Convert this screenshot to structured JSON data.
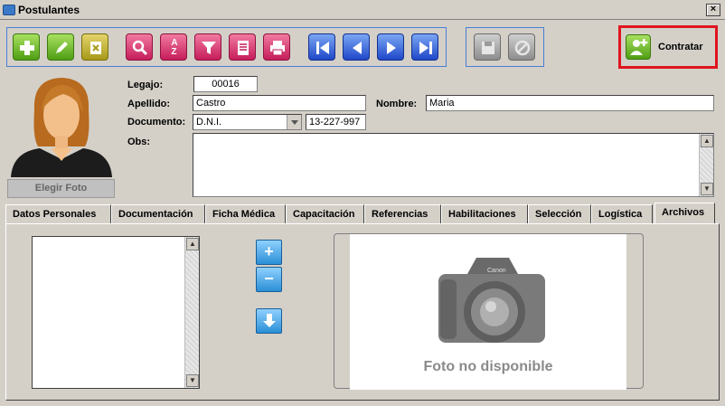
{
  "window": {
    "title": "Postulantes",
    "close": "×"
  },
  "toolbar": {
    "edit_group": [
      "add-icon",
      "edit-icon",
      "delete-icon"
    ],
    "action_group": [
      "search-icon",
      "sort-icon",
      "filter-icon",
      "list-icon",
      "print-icon"
    ],
    "nav_group": [
      "first-icon",
      "prev-icon",
      "next-icon",
      "last-icon"
    ],
    "save_group": [
      "save-icon",
      "cancel-icon"
    ],
    "contratar_label": "Contratar"
  },
  "form": {
    "legajo_label": "Legajo:",
    "legajo_value": "00016",
    "apellido_label": "Apellido:",
    "apellido_value": "Castro",
    "nombre_label": "Nombre:",
    "nombre_value": "Maria",
    "documento_label": "Documento:",
    "documento_type": "D.N.I.",
    "documento_value": "13-227-997",
    "obs_label": "Obs:",
    "obs_value": ""
  },
  "photo": {
    "button_label": "Elegir Foto"
  },
  "tabs": [
    {
      "label": "Datos Personales"
    },
    {
      "label": "Documentación"
    },
    {
      "label": "Ficha Médica"
    },
    {
      "label": "Capacitación"
    },
    {
      "label": "Referencias"
    },
    {
      "label": "Habilitaciones"
    },
    {
      "label": "Selección"
    },
    {
      "label": "Logística"
    },
    {
      "label": "Archivos"
    }
  ],
  "active_tab": "Archivos",
  "archivos": {
    "camera_brand": "Canon",
    "no_photo_text": "Foto no disponible"
  },
  "colors": {
    "highlight_border": "#e0141e",
    "toolbar_border": "#4a7fd4"
  }
}
